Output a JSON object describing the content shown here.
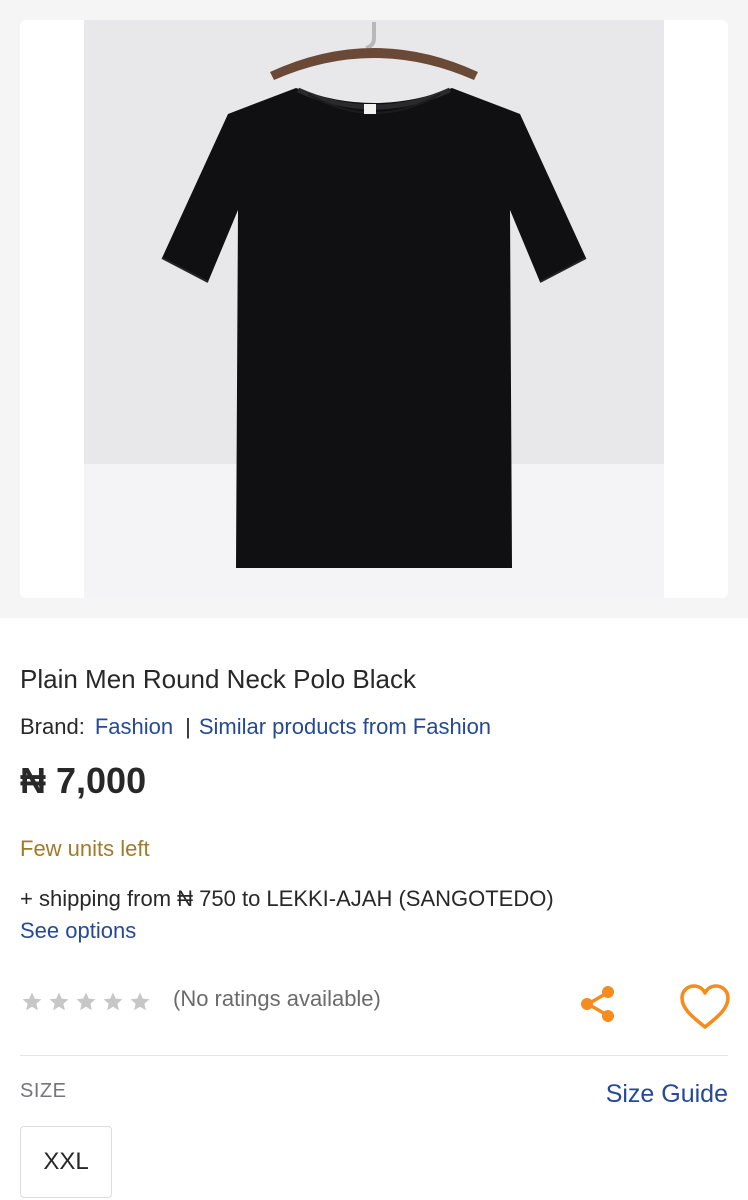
{
  "product": {
    "title": "Plain Men Round Neck Polo Black",
    "image_alt_icon": "black-tshirt-image",
    "brand_label": "Brand:",
    "brand_name": "Fashion",
    "brand_separator": "|",
    "similar_link": "Similar products from Fashion",
    "price": "₦ 7,000",
    "stock_status": "Few units left",
    "shipping_text": "+ shipping from ₦ 750 to LEKKI-AJAH (SANGOTEDO)",
    "see_options": "See options"
  },
  "rating": {
    "stars_filled": 0,
    "stars_total": 5,
    "text": "(No ratings available)"
  },
  "actions": {
    "share_icon": "share-icon",
    "wishlist_icon": "heart-icon"
  },
  "size": {
    "label": "SIZE",
    "guide_link": "Size Guide",
    "options": [
      "XXL"
    ]
  },
  "colors": {
    "link": "#264996",
    "accent_orange": "#f68b1e",
    "stock_text": "#a07b29",
    "star_empty": "#c7c7c7"
  }
}
